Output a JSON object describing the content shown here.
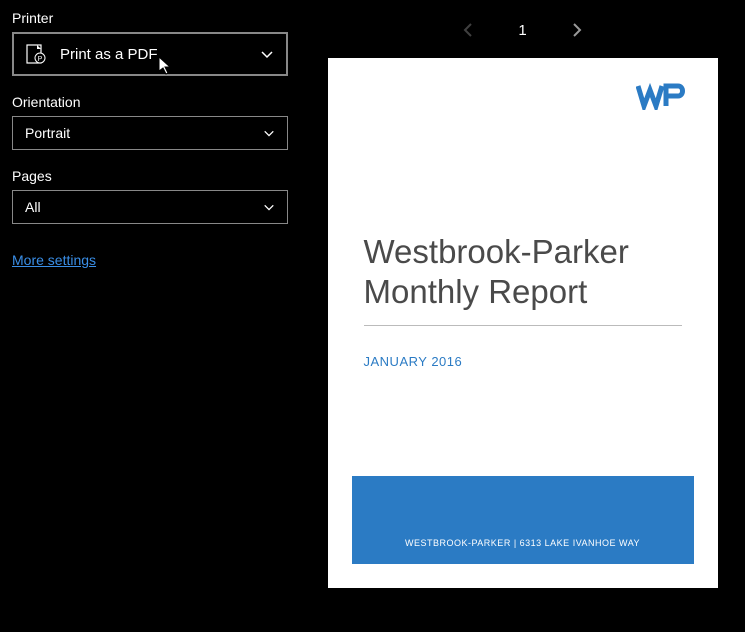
{
  "labels": {
    "printer": "Printer",
    "orientation": "Orientation",
    "pages": "Pages"
  },
  "printer": {
    "selected": "Print as a PDF"
  },
  "orientation": {
    "selected": "Portrait"
  },
  "pages": {
    "selected": "All"
  },
  "more_settings": "More settings",
  "pager": {
    "current": "1"
  },
  "document": {
    "logo": "WP",
    "title_line1": "Westbrook-Parker",
    "title_line2": "Monthly Report",
    "subtitle": "JANUARY 2016",
    "footer": "WESTBROOK-PARKER | 6313 LAKE IVANHOE WAY"
  }
}
